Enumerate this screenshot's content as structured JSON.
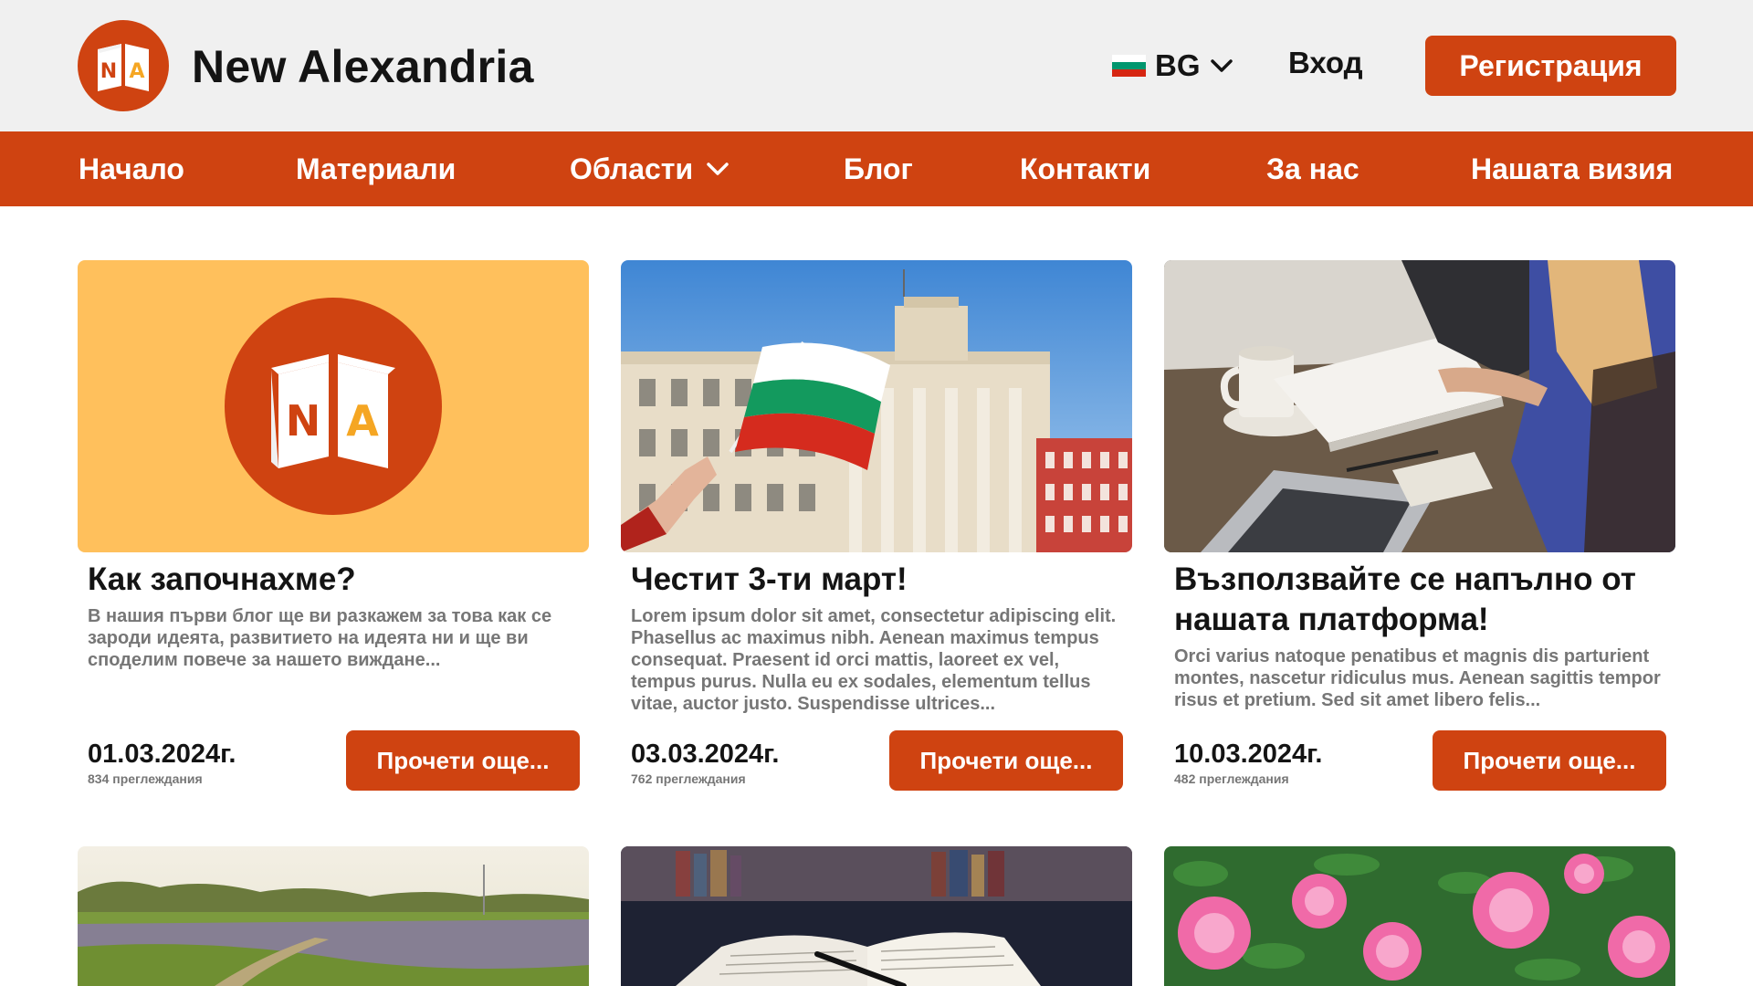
{
  "header": {
    "brand": "New Alexandria",
    "logo_letters": {
      "left": "N",
      "right": "A"
    },
    "language": "BG",
    "login_label": "Вход",
    "register_label": "Регистрация"
  },
  "nav": {
    "items": [
      {
        "label": "Начало"
      },
      {
        "label": "Материали"
      },
      {
        "label": "Области",
        "has_dropdown": true
      },
      {
        "label": "Блог"
      },
      {
        "label": "Контакти"
      },
      {
        "label": "За нас"
      },
      {
        "label": "Нашата визия"
      }
    ]
  },
  "posts": [
    {
      "title": "Как започнахме?",
      "excerpt": "В нашия първи блог ще ви разкажем за това как се зароди идеята, развитието на идеята ни и ще ви споделим повече за нашето виждане...",
      "date": "01.03.2024г.",
      "views": "834 преглеждания",
      "button": "Прочети още..."
    },
    {
      "title": "Честит 3-ти март!",
      "excerpt": "Lorem ipsum dolor sit amet, consectetur adipiscing elit. Phasellus ac maximus nibh. Aenean maximus tempus consequat. Praesent id orci mattis, laoreet ex vel, tempus purus. Nulla eu ex sodales, elementum tellus vitae, auctor justo. Suspendisse ultrices...",
      "date": "03.03.2024г.",
      "views": "762 преглеждания",
      "button": "Прочети още..."
    },
    {
      "title": "Възползвайте се напълно от нашата платформа!",
      "excerpt": "Orci varius natoque penatibus et magnis dis parturient montes, nascetur ridiculus mus. Aenean sagittis tempor risus et pretium. Sed sit amet libero felis...",
      "date": "10.03.2024г.",
      "views": "482 преглеждания",
      "button": "Прочети още..."
    }
  ],
  "colors": {
    "accent": "#cf4311",
    "header_bg": "#f0f0f0",
    "logo_card_bg": "#ffc05c",
    "logo_letter_right": "#f5a623"
  },
  "icons": [
    "logo-book-icon",
    "bulgaria-flag-icon",
    "chevron-down-icon"
  ]
}
